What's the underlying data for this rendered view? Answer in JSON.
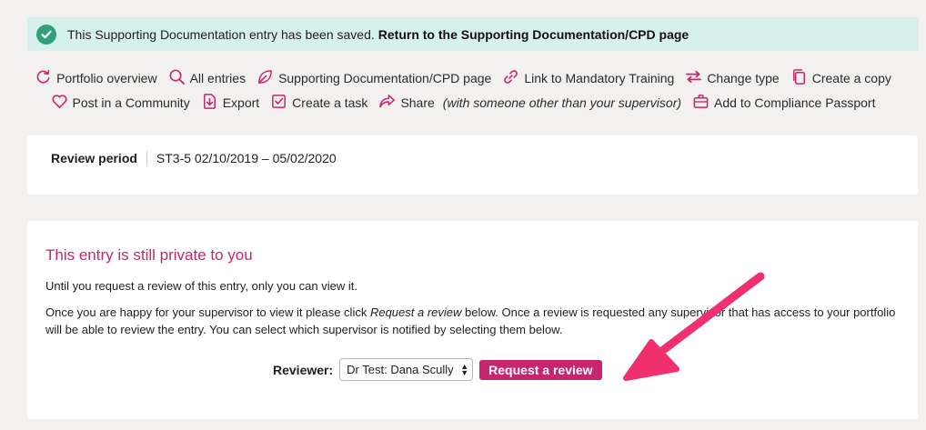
{
  "alert": {
    "message": "This Supporting Documentation entry has been saved.",
    "link": "Return to the Supporting Documentation/CPD page",
    "icon": "check-circle-icon",
    "color": "#d6f0eb"
  },
  "actions": {
    "row1": [
      {
        "label": "Portfolio overview",
        "icon": "refresh-icon"
      },
      {
        "label": "All entries",
        "icon": "search-icon"
      },
      {
        "label": "Supporting Documentation/CPD page",
        "icon": "leaf-icon"
      },
      {
        "label": "Link to Mandatory Training",
        "icon": "link-icon"
      },
      {
        "label": "Change type",
        "icon": "swap-icon"
      },
      {
        "label": "Create a copy",
        "icon": "copy-icon"
      }
    ],
    "row2": [
      {
        "label": "Post in a Community",
        "icon": "heart-icon"
      },
      {
        "label": "Export",
        "icon": "export-icon"
      },
      {
        "label": "Create a task",
        "icon": "checkbox-icon"
      },
      {
        "label": "Share",
        "note": "(with someone other than your supervisor)",
        "icon": "share-icon"
      },
      {
        "label": "Add to Compliance Passport",
        "icon": "briefcase-icon"
      }
    ],
    "accent": "#c8256f"
  },
  "review_period": {
    "label": "Review period",
    "value": "ST3-5 02/10/2019 – 05/02/2020"
  },
  "private_notice": {
    "heading": "This entry is still private to you",
    "para1": "Until you request a review of this entry, only you can view it.",
    "para2_before": "Once you are happy for your supervisor to view it please click ",
    "para2_em": "Request a review",
    "para2_after": " below. Once a review is requested any supervisor that has access to your portfolio will be able to review the entry. You can select which supervisor is notified by selecting them below.",
    "reviewer_label": "Reviewer:",
    "reviewer_selected": "Dr Test: Dana Scully",
    "request_button": "Request a review"
  },
  "annotation": {
    "arrow_color": "#f0306e"
  }
}
